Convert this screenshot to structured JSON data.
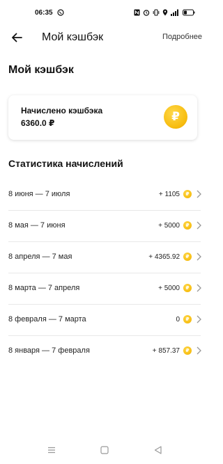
{
  "status_bar": {
    "time": "06:35",
    "icons": [
      "whatsapp-icon",
      "nfc-icon",
      "alarm-icon",
      "vibrate-icon",
      "location-icon",
      "signal-icon",
      "battery-icon"
    ]
  },
  "header": {
    "title": "Мой кэшбэк",
    "link": "Подробнее",
    "back_icon": "arrow-left-icon"
  },
  "page_title": "Мой кэшбэк",
  "card": {
    "label": "Начислено кэшбэка",
    "amount": "6360.0 ₽",
    "coin_symbol": "₽"
  },
  "stats": {
    "title": "Статистика начислений",
    "coin_symbol": "₽",
    "rows": [
      {
        "period": "8 июня — 7 июля",
        "value": "+ 1105"
      },
      {
        "period": "8 мая — 7 июня",
        "value": "+ 5000"
      },
      {
        "period": "8 апреля — 7 мая",
        "value": "+ 4365.92"
      },
      {
        "period": "8 марта — 7 апреля",
        "value": "+ 5000"
      },
      {
        "period": "8 февраля — 7 марта",
        "value": "0"
      },
      {
        "period": "8 января — 7 февраля",
        "value": "+ 857.37"
      }
    ]
  },
  "nav": {
    "icons": [
      "menu-icon",
      "home-icon",
      "back-triangle-icon"
    ]
  },
  "colors": {
    "accent": "#F7BD10",
    "text": "#111111",
    "divider": "#E8E8E8"
  }
}
